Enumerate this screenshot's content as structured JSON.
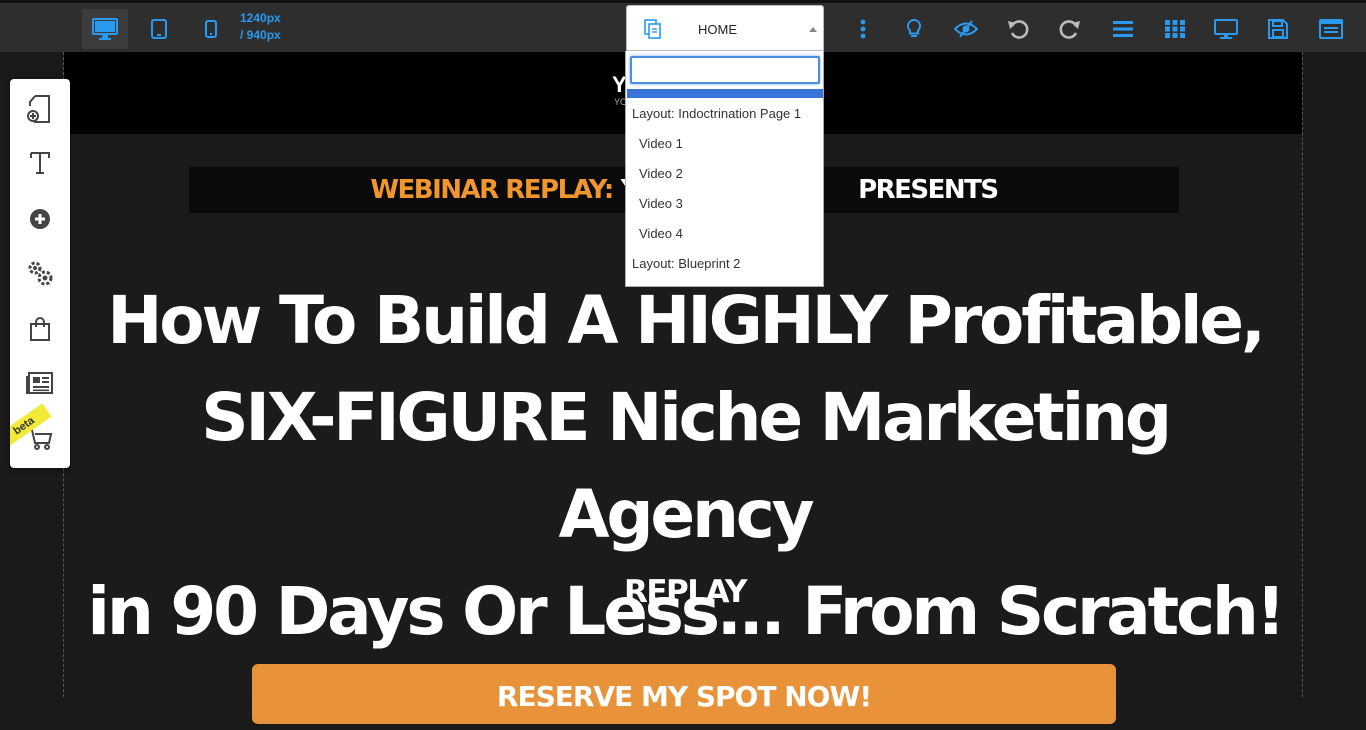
{
  "toolbar": {
    "device_buttons": [
      "desktop",
      "tablet",
      "mobile"
    ],
    "dimensions_line1": "1240px",
    "dimensions_line2": "/ 940px",
    "page_select": {
      "selected": "HOME",
      "search_value": "",
      "options": [
        {
          "label": "Layout: Indoctrination Page 1",
          "type": "group"
        },
        {
          "label": "Video 1",
          "type": "item"
        },
        {
          "label": "Video 2",
          "type": "item"
        },
        {
          "label": "Video 3",
          "type": "item"
        },
        {
          "label": "Video 4",
          "type": "item"
        },
        {
          "label": "Layout: Blueprint 2",
          "type": "group"
        }
      ]
    },
    "right_icons": [
      "more-vertical-icon",
      "lightbulb-icon",
      "eye-code-icon",
      "undo-icon",
      "redo-icon",
      "list-icon",
      "grid-icon",
      "monitor-icon",
      "save-icon",
      "settings-window-icon"
    ],
    "accent_color": "#2a9af0"
  },
  "tools_panel": {
    "items": [
      "add-page-icon",
      "text-icon",
      "add-element-icon",
      "settings-gears-icon",
      "shopping-bag-icon",
      "newspaper-icon",
      "cart-icon"
    ],
    "beta_label": "beta"
  },
  "page": {
    "logo_main": "Y",
    "logo_sub": "YO",
    "banner_orange": "WEBINAR REPLAY:",
    "banner_white_a": "Y",
    "banner_white_b": "PRESENTS",
    "headline_line1": "How To Build A HIGHLY Profitable,",
    "headline_line2": "SIX-FIGURE Niche Marketing Agency",
    "headline_line3": "in 90 Days Or Less... From Scratch!",
    "replay_label": "REPLAY",
    "cta_label": "RESERVE MY SPOT NOW!",
    "accent_orange": "#f0962d"
  }
}
